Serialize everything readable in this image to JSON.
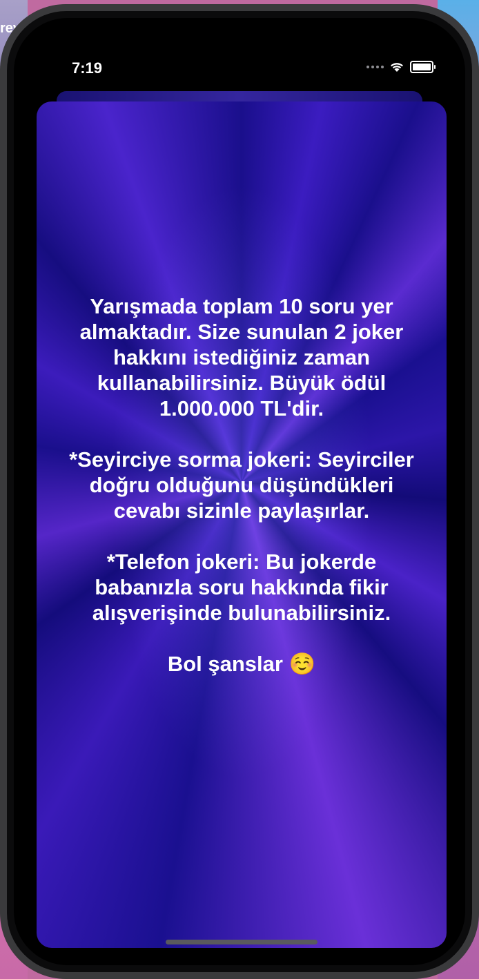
{
  "status_bar": {
    "time": "7:19",
    "wifi_icon": "wifi-icon",
    "battery_icon": "battery-icon"
  },
  "desktop": {
    "partial_label": "rev"
  },
  "info": {
    "paragraph_1": "Yarışmada toplam 10 soru yer almaktadır. Size sunulan 2 joker hakkını istediğiniz zaman kullanabilirsiniz. Büyük ödül 1.000.000 TL'dir.",
    "paragraph_2": "*Seyirciye sorma jokeri: Seyirciler doğru olduğunu düşündükleri cevabı sizinle paylaşırlar.",
    "paragraph_3": "*Telefon jokeri: Bu jokerde babanızla soru hakkında fikir alışverişinde bulunabilirsiniz.",
    "paragraph_4": "Bol şanslar ☺️"
  },
  "colors": {
    "background_primary": "#1a0f8c",
    "background_accent": "#5a2bd0",
    "text": "#ffffff"
  }
}
